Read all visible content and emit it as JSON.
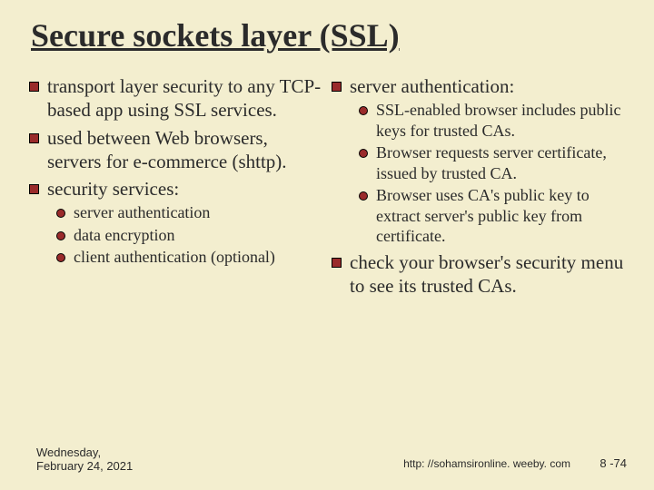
{
  "title": "Secure sockets layer (SSL)",
  "left": {
    "items": [
      {
        "text": "transport layer security to any TCP-based app using SSL services."
      },
      {
        "text": "used between Web browsers, servers for e-commerce (shttp)."
      },
      {
        "text": "security services:"
      }
    ],
    "subitems": [
      {
        "text": "server authentication"
      },
      {
        "text": "data encryption"
      },
      {
        "text": "client authentication (optional)"
      }
    ]
  },
  "right": {
    "items_a": [
      {
        "text": "server authentication:"
      }
    ],
    "subitems": [
      {
        "text": "SSL-enabled browser includes public keys for trusted CAs."
      },
      {
        "text": "Browser requests server certificate, issued by trusted CA."
      },
      {
        "text": "Browser uses CA's public key to extract server's public key from certificate."
      }
    ],
    "items_b": [
      {
        "text": "check your browser's security menu to see its trusted CAs."
      }
    ]
  },
  "footer": {
    "date_line1": "Wednesday,",
    "date_line2": "February 24, 2021",
    "url": "http: //sohamsironline. weeby. com",
    "page": "8 -74"
  }
}
